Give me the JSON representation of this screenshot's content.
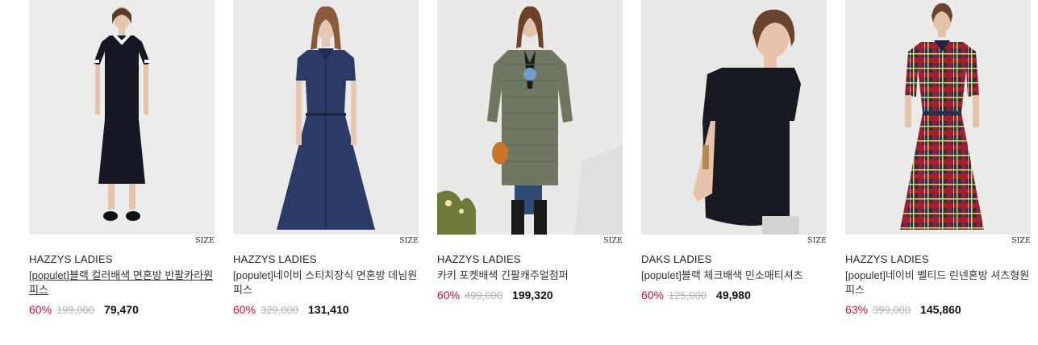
{
  "products": [
    {
      "size_label": "SIZE",
      "brand": "HAZZYS LADIES",
      "name": "[populet]블랙 컬러배색 면혼방 반팔카라원피스",
      "discount": "60%",
      "original_price": "199,000",
      "sale_price": "79,470",
      "image": "model-black-polo-dress-photo"
    },
    {
      "size_label": "SIZE",
      "brand": "HAZZYS LADIES",
      "name": "[populet]네이비 스티치장식 면혼방 데님원피스",
      "discount": "60%",
      "original_price": "329,000",
      "sale_price": "131,410",
      "image": "model-navy-denim-dress-photo"
    },
    {
      "size_label": "SIZE",
      "brand": "HAZZYS LADIES",
      "name": "카키 포켓배색 긴팔캐주얼점퍼",
      "discount": "60%",
      "original_price": "499,000",
      "sale_price": "199,320",
      "image": "model-khaki-quilted-jacket-photo"
    },
    {
      "size_label": "SIZE",
      "brand": "DAKS LADIES",
      "name": "[populet]블랙 체크배색 민소매티셔츠",
      "discount": "60%",
      "original_price": "125,000",
      "sale_price": "49,980",
      "image": "model-black-sleeveless-tee-photo"
    },
    {
      "size_label": "SIZE",
      "brand": "HAZZYS LADIES",
      "name": "[populet]네이비 벨티드 린넨혼방 셔츠형원피스",
      "discount": "63%",
      "original_price": "399,000",
      "sale_price": "145,860",
      "image": "model-plaid-shirt-dress-photo"
    }
  ],
  "colors": {
    "discount": "#c8102e",
    "original_price": "#b3b3b3",
    "photo_background": "#ededed"
  }
}
